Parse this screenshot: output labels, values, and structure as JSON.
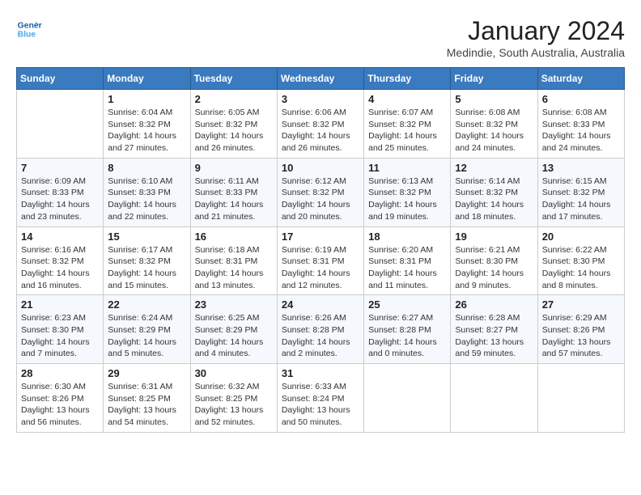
{
  "header": {
    "logo_line1": "General",
    "logo_line2": "Blue",
    "month": "January 2024",
    "location": "Medindie, South Australia, Australia"
  },
  "weekdays": [
    "Sunday",
    "Monday",
    "Tuesday",
    "Wednesday",
    "Thursday",
    "Friday",
    "Saturday"
  ],
  "weeks": [
    [
      {
        "day": "",
        "info": ""
      },
      {
        "day": "1",
        "info": "Sunrise: 6:04 AM\nSunset: 8:32 PM\nDaylight: 14 hours\nand 27 minutes."
      },
      {
        "day": "2",
        "info": "Sunrise: 6:05 AM\nSunset: 8:32 PM\nDaylight: 14 hours\nand 26 minutes."
      },
      {
        "day": "3",
        "info": "Sunrise: 6:06 AM\nSunset: 8:32 PM\nDaylight: 14 hours\nand 26 minutes."
      },
      {
        "day": "4",
        "info": "Sunrise: 6:07 AM\nSunset: 8:32 PM\nDaylight: 14 hours\nand 25 minutes."
      },
      {
        "day": "5",
        "info": "Sunrise: 6:08 AM\nSunset: 8:32 PM\nDaylight: 14 hours\nand 24 minutes."
      },
      {
        "day": "6",
        "info": "Sunrise: 6:08 AM\nSunset: 8:33 PM\nDaylight: 14 hours\nand 24 minutes."
      }
    ],
    [
      {
        "day": "7",
        "info": "Sunrise: 6:09 AM\nSunset: 8:33 PM\nDaylight: 14 hours\nand 23 minutes."
      },
      {
        "day": "8",
        "info": "Sunrise: 6:10 AM\nSunset: 8:33 PM\nDaylight: 14 hours\nand 22 minutes."
      },
      {
        "day": "9",
        "info": "Sunrise: 6:11 AM\nSunset: 8:33 PM\nDaylight: 14 hours\nand 21 minutes."
      },
      {
        "day": "10",
        "info": "Sunrise: 6:12 AM\nSunset: 8:32 PM\nDaylight: 14 hours\nand 20 minutes."
      },
      {
        "day": "11",
        "info": "Sunrise: 6:13 AM\nSunset: 8:32 PM\nDaylight: 14 hours\nand 19 minutes."
      },
      {
        "day": "12",
        "info": "Sunrise: 6:14 AM\nSunset: 8:32 PM\nDaylight: 14 hours\nand 18 minutes."
      },
      {
        "day": "13",
        "info": "Sunrise: 6:15 AM\nSunset: 8:32 PM\nDaylight: 14 hours\nand 17 minutes."
      }
    ],
    [
      {
        "day": "14",
        "info": "Sunrise: 6:16 AM\nSunset: 8:32 PM\nDaylight: 14 hours\nand 16 minutes."
      },
      {
        "day": "15",
        "info": "Sunrise: 6:17 AM\nSunset: 8:32 PM\nDaylight: 14 hours\nand 15 minutes."
      },
      {
        "day": "16",
        "info": "Sunrise: 6:18 AM\nSunset: 8:31 PM\nDaylight: 14 hours\nand 13 minutes."
      },
      {
        "day": "17",
        "info": "Sunrise: 6:19 AM\nSunset: 8:31 PM\nDaylight: 14 hours\nand 12 minutes."
      },
      {
        "day": "18",
        "info": "Sunrise: 6:20 AM\nSunset: 8:31 PM\nDaylight: 14 hours\nand 11 minutes."
      },
      {
        "day": "19",
        "info": "Sunrise: 6:21 AM\nSunset: 8:30 PM\nDaylight: 14 hours\nand 9 minutes."
      },
      {
        "day": "20",
        "info": "Sunrise: 6:22 AM\nSunset: 8:30 PM\nDaylight: 14 hours\nand 8 minutes."
      }
    ],
    [
      {
        "day": "21",
        "info": "Sunrise: 6:23 AM\nSunset: 8:30 PM\nDaylight: 14 hours\nand 7 minutes."
      },
      {
        "day": "22",
        "info": "Sunrise: 6:24 AM\nSunset: 8:29 PM\nDaylight: 14 hours\nand 5 minutes."
      },
      {
        "day": "23",
        "info": "Sunrise: 6:25 AM\nSunset: 8:29 PM\nDaylight: 14 hours\nand 4 minutes."
      },
      {
        "day": "24",
        "info": "Sunrise: 6:26 AM\nSunset: 8:28 PM\nDaylight: 14 hours\nand 2 minutes."
      },
      {
        "day": "25",
        "info": "Sunrise: 6:27 AM\nSunset: 8:28 PM\nDaylight: 14 hours\nand 0 minutes."
      },
      {
        "day": "26",
        "info": "Sunrise: 6:28 AM\nSunset: 8:27 PM\nDaylight: 13 hours\nand 59 minutes."
      },
      {
        "day": "27",
        "info": "Sunrise: 6:29 AM\nSunset: 8:26 PM\nDaylight: 13 hours\nand 57 minutes."
      }
    ],
    [
      {
        "day": "28",
        "info": "Sunrise: 6:30 AM\nSunset: 8:26 PM\nDaylight: 13 hours\nand 56 minutes."
      },
      {
        "day": "29",
        "info": "Sunrise: 6:31 AM\nSunset: 8:25 PM\nDaylight: 13 hours\nand 54 minutes."
      },
      {
        "day": "30",
        "info": "Sunrise: 6:32 AM\nSunset: 8:25 PM\nDaylight: 13 hours\nand 52 minutes."
      },
      {
        "day": "31",
        "info": "Sunrise: 6:33 AM\nSunset: 8:24 PM\nDaylight: 13 hours\nand 50 minutes."
      },
      {
        "day": "",
        "info": ""
      },
      {
        "day": "",
        "info": ""
      },
      {
        "day": "",
        "info": ""
      }
    ]
  ]
}
